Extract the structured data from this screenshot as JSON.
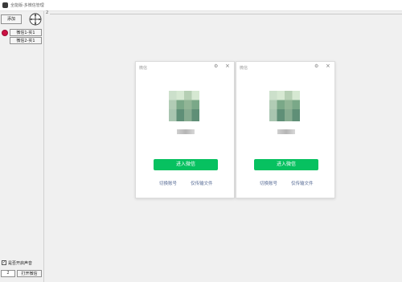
{
  "app": {
    "title": "全能版-多微信管理"
  },
  "left_panel": {
    "add_label": "添加",
    "instances": [
      {
        "label": "微信1-实1",
        "status_color": "#cc1144"
      },
      {
        "label": "微信2-实1"
      }
    ],
    "sound_label": "是否开启声音",
    "sound_checked": true,
    "count_value": "2",
    "open_label": "打开微信"
  },
  "workspace": {
    "marker": "2"
  },
  "wechat_windows": [
    {
      "title": "微信",
      "enter_label": "进入微信",
      "switch_label": "切换账号",
      "transfer_label": "仅传输文件"
    },
    {
      "title": "微信",
      "enter_label": "进入微信",
      "switch_label": "切换账号",
      "transfer_label": "仅传输文件"
    }
  ],
  "icons": {
    "app": "app-icon",
    "crosshair": "crosshair-icon",
    "settings": "settings-icon",
    "close": "close-icon",
    "check": "✓"
  },
  "colors": {
    "accent_green": "#07c160",
    "link_blue": "#576b95",
    "status_red": "#cc1144"
  }
}
